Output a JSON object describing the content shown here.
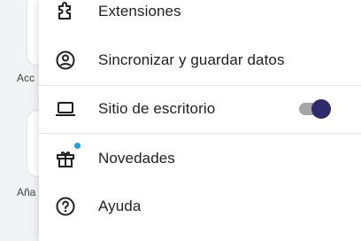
{
  "background": {
    "tile_labels": [
      "Acc",
      "Aña"
    ]
  },
  "menu": {
    "items": [
      {
        "label": "Extensiones",
        "icon": "puzzle-icon"
      },
      {
        "label": "Sincronizar y guardar datos",
        "icon": "account-circle-icon"
      },
      {
        "label": "Sitio de escritorio",
        "icon": "laptop-icon",
        "toggle_on": true
      },
      {
        "label": "Novedades",
        "icon": "gift-icon",
        "badge_color": "#1aa3e8"
      },
      {
        "label": "Ayuda",
        "icon": "help-icon"
      }
    ]
  },
  "colors": {
    "toggle_thumb": "#2d2a6e",
    "toggle_track": "#a6a6a6",
    "badge": "#1aa3e8"
  }
}
